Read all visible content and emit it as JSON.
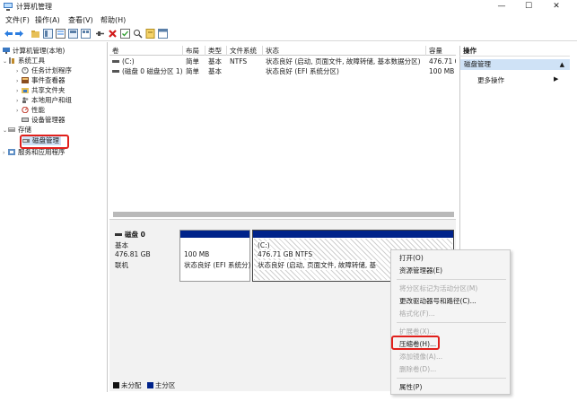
{
  "window": {
    "title": "计算机管理",
    "controls": {
      "minimize": "—",
      "maximize": "☐",
      "close": "✕"
    }
  },
  "menubar": [
    {
      "label": "文件(F)"
    },
    {
      "label": "操作(A)"
    },
    {
      "label": "查看(V)"
    },
    {
      "label": "帮助(H)"
    }
  ],
  "tree": {
    "root": "计算机管理(本地)",
    "system_tools": "系统工具",
    "task_scheduler": "任务计划程序",
    "event_viewer": "事件查看器",
    "shared_folders": "共享文件夹",
    "local_users": "本地用户和组",
    "performance": "性能",
    "device_manager": "设备管理器",
    "storage": "存储",
    "disk_management": "磁盘管理",
    "services_apps": "服务和应用程序"
  },
  "volume_list": {
    "headers": [
      "卷",
      "布局",
      "类型",
      "文件系统",
      "状态",
      "容量"
    ],
    "rows": [
      [
        "(C:)",
        "简单",
        "基本",
        "NTFS",
        "状态良好 (启动, 页面文件, 故障转储, 基本数据分区)",
        "476.71 G"
      ],
      [
        "(磁盘 0 磁盘分区 1)",
        "简单",
        "基本",
        "",
        "状态良好 (EFI 系统分区)",
        "100 MB"
      ]
    ]
  },
  "disk": {
    "name": "磁盘 0",
    "type": "基本",
    "size": "476.81 GB",
    "status": "联机",
    "partitions": [
      {
        "size": "100 MB",
        "status": "状态良好 (EFI 系统分)"
      },
      {
        "name": "(C:)",
        "size": "476.71 GB NTFS",
        "status": "状态良好 (启动, 页面文件, 故障转储, 基"
      }
    ]
  },
  "legend": {
    "unallocated": "未分配",
    "primary": "主分区",
    "unallocated_color": "#111111",
    "primary_color": "#00238a"
  },
  "actions": {
    "header": "操作",
    "selected": "磁盘管理",
    "more": "更多操作"
  },
  "context_menu": {
    "items": [
      {
        "label": "打开(O)",
        "enabled": true
      },
      {
        "label": "资源管理器(E)",
        "enabled": true
      },
      {
        "label": "将分区标记为活动分区(M)",
        "enabled": false
      },
      {
        "label": "更改驱动器号和路径(C)...",
        "enabled": true
      },
      {
        "label": "格式化(F)...",
        "enabled": false
      },
      {
        "label": "扩展卷(X)...",
        "enabled": false
      },
      {
        "label": "压缩卷(H)...",
        "enabled": true
      },
      {
        "label": "添加镜像(A)...",
        "enabled": false
      },
      {
        "label": "删除卷(D)...",
        "enabled": false
      },
      {
        "label": "属性(P)",
        "enabled": true
      }
    ]
  },
  "highlight_color": "#e0201c"
}
